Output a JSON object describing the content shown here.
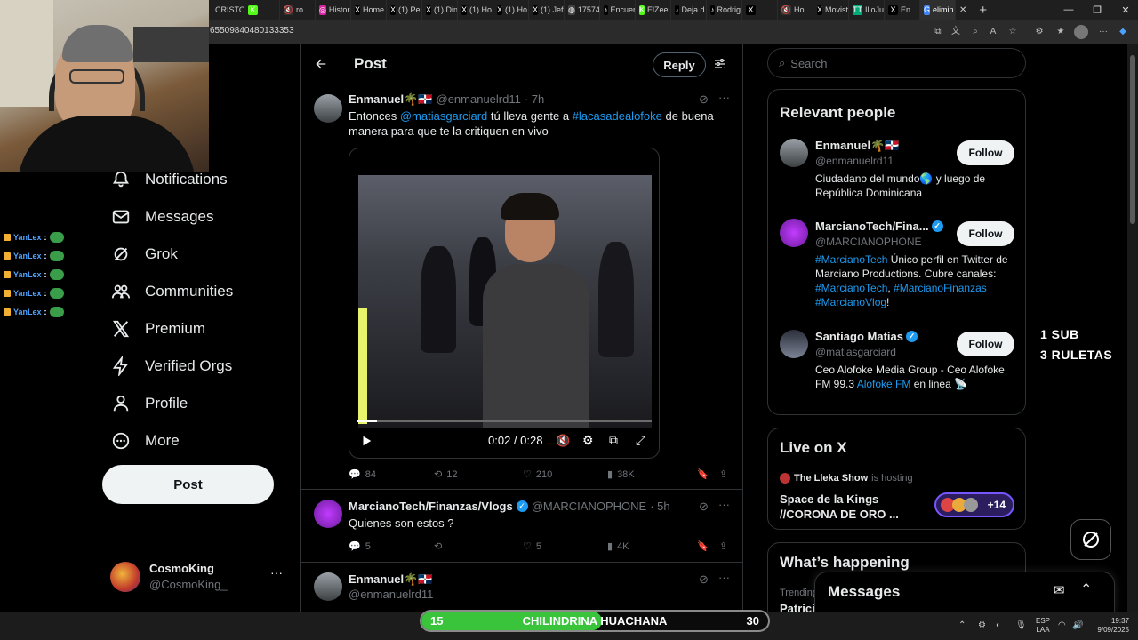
{
  "browser": {
    "tabs": [
      {
        "icon": "",
        "label": "CRISTO",
        "color": "#e53935"
      },
      {
        "icon": "K",
        "label": "",
        "color": "#53fc18"
      },
      {
        "icon": "🔇",
        "label": "ro",
        "color": "#333"
      },
      {
        "icon": "◎",
        "label": "Histori",
        "color": "#d6249f"
      },
      {
        "icon": "X",
        "label": "Home",
        "color": "#000"
      },
      {
        "icon": "X",
        "label": "(1) Per",
        "color": "#000"
      },
      {
        "icon": "X",
        "label": "(1) Din",
        "color": "#000"
      },
      {
        "icon": "X",
        "label": "(1) Ho",
        "color": "#000"
      },
      {
        "icon": "X",
        "label": "(1) Ho",
        "color": "#000"
      },
      {
        "icon": "X",
        "label": "(1) Jef",
        "color": "#000"
      },
      {
        "icon": "◍",
        "label": "17574",
        "color": "#444"
      },
      {
        "icon": "♪",
        "label": "Encuer",
        "color": "#000"
      },
      {
        "icon": "K",
        "label": "ElZeein",
        "color": "#53fc18"
      },
      {
        "icon": "♪",
        "label": "Deja d",
        "color": "#000"
      },
      {
        "icon": "♪",
        "label": "Rodrig",
        "color": "#000"
      },
      {
        "icon": "X",
        "label": "",
        "color": "#000"
      },
      {
        "icon": "🔇",
        "label": "Ho",
        "color": "#333"
      },
      {
        "icon": "X",
        "label": "Movist",
        "color": "#000"
      },
      {
        "icon": "TT",
        "label": "IlloJua",
        "color": "#0a7"
      },
      {
        "icon": "X",
        "label": "En",
        "color": "#000"
      },
      {
        "icon": "G",
        "label": "elimin",
        "color": "#4285f4"
      }
    ],
    "close_tab": "✕",
    "new_tab": "+",
    "url": "65509840480133353"
  },
  "chat": {
    "lines": [
      {
        "user": "YanLex",
        "sep": ":"
      },
      {
        "user": "YanLex",
        "sep": ":"
      },
      {
        "user": "YanLex",
        "sep": ":"
      },
      {
        "user": "YanLex",
        "sep": ":"
      },
      {
        "user": "YanLex",
        "sep": ":"
      }
    ]
  },
  "nav": {
    "items": [
      {
        "label": "Notifications",
        "icon": "bell-icon"
      },
      {
        "label": "Messages",
        "icon": "envelope-icon"
      },
      {
        "label": "Grok",
        "icon": "grok-icon"
      },
      {
        "label": "Communities",
        "icon": "communities-icon"
      },
      {
        "label": "Premium",
        "icon": "x-logo-icon"
      },
      {
        "label": "Verified Orgs",
        "icon": "lightning-icon"
      },
      {
        "label": "Profile",
        "icon": "person-icon"
      },
      {
        "label": "More",
        "icon": "more-circle-icon"
      }
    ],
    "post_button": "Post",
    "account": {
      "name": "CosmoKing",
      "handle": "@CosmoKing_",
      "menu": "···"
    }
  },
  "post_page": {
    "title": "Post",
    "reply_button": "Reply",
    "main_tweet": {
      "name": "Enmanuel🌴🇩🇴",
      "handle": "@enmanuelrd11",
      "time": "· 7h",
      "text_pre": "Entonces ",
      "mention": "@matiasgarciard",
      "text_mid": " tú lleva gente a ",
      "hashtag": "#lacasadealofoke",
      "text_post": " de buena manera  para que te la critiquen en vivo",
      "video": {
        "time": "0:02 / 0:28",
        "progress": 0.07
      },
      "stats": {
        "replies": "84",
        "reposts": "12",
        "likes": "210",
        "views": "38K"
      }
    },
    "reply_1": {
      "name": "MarcianoTech/Finanzas/Vlogs",
      "handle": "@MARCIANOPHONE",
      "time": "· 5h",
      "text": "Quienes son estos ?",
      "stats": {
        "replies": "5",
        "reposts": "",
        "likes": "5",
        "views": "4K"
      }
    },
    "reply_2": {
      "name": "Enmanuel🌴🇩🇴",
      "handle": "@enmanuelrd11"
    }
  },
  "search": {
    "placeholder": "Search"
  },
  "relevant_people": {
    "title": "Relevant people",
    "people": [
      {
        "name": "Enmanuel🌴🇩🇴",
        "handle": "@enmanuelrd11",
        "bio": "Ciudadano del mundo🌎 y luego de República Dominicana",
        "follow": "Follow",
        "verified": false
      },
      {
        "name": "MarcianoTech/Fina...",
        "handle": "@MARCIANOPHONE",
        "bio_parts": [
          "#MarcianoTech",
          " Único perfil en Twitter de Marciano Productions. Cubre canales: ",
          "#MarcianoTech",
          ", ",
          "#MarcianoFinanzas",
          " ",
          "#MarcianoVlog",
          "!"
        ],
        "follow": "Follow",
        "verified": true
      },
      {
        "name": "Santiago Matias",
        "handle": "@matiasgarciard",
        "bio_pre": "Ceo Alofoke Media Group - Ceo Alofoke FM 99.3 ",
        "bio_link": "Alofoke.FM",
        "bio_post": " en linea 📡",
        "follow": "Follow",
        "verified": true
      }
    ]
  },
  "live": {
    "title": "Live on X",
    "host": "The Lleka Show",
    "hosting": "is hosting",
    "space_title": "Space de la Kings //CORONA DE ORO ...",
    "listeners": "+14"
  },
  "happening": {
    "title": "What’s happening",
    "trending": "Trending",
    "trend_partial": "Patrici"
  },
  "messages_dock": {
    "title": "Messages"
  },
  "overlay": {
    "sub_line1": "1 SUB",
    "sub_line2": "3 RULETAS"
  },
  "game_bar": {
    "left": "15",
    "title": "CHILINDRINA HUACHANA",
    "right": "30",
    "fill": 0.52
  },
  "taskbar": {
    "lang1": "ESP",
    "lang2": "LAA",
    "time": "19:37",
    "date": "9/09/2025"
  },
  "colors": {
    "accent": "#1d9bf0",
    "green": "#39c43c"
  }
}
